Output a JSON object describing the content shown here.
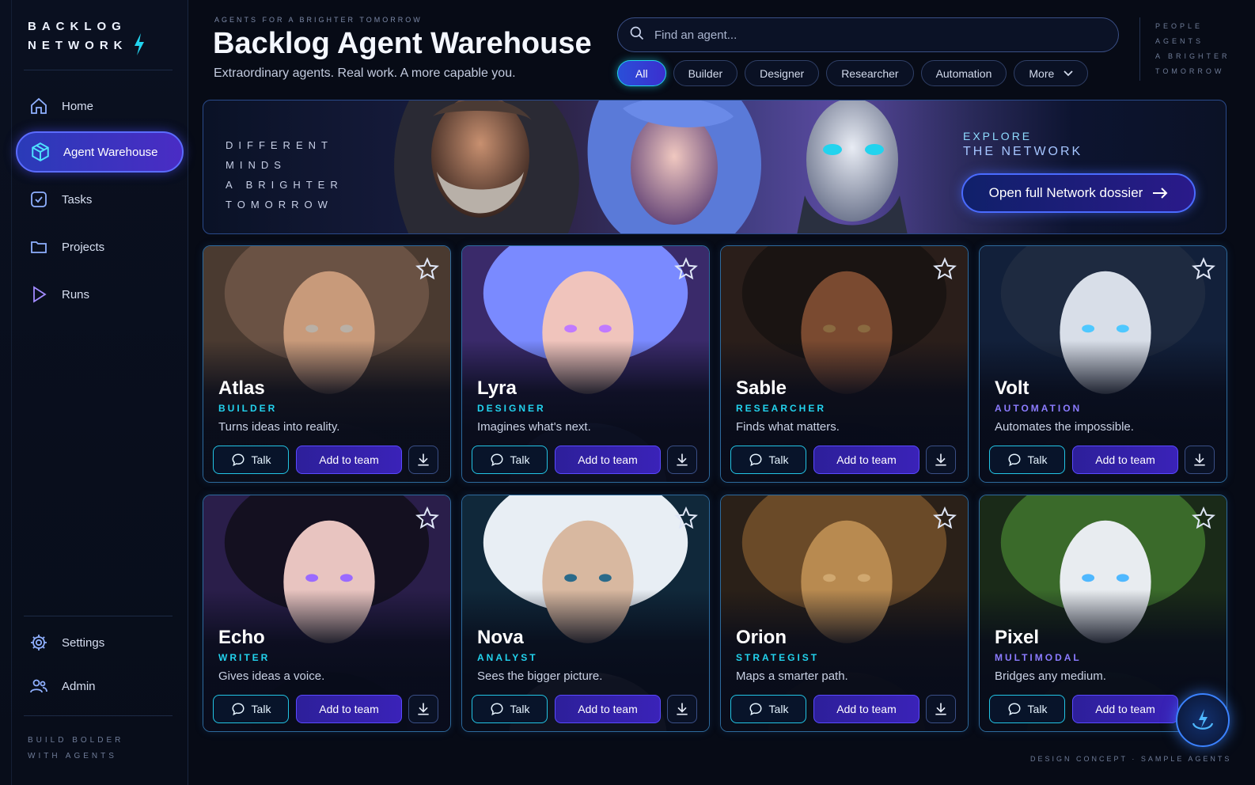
{
  "brand": {
    "line1": "BACKLOG",
    "line2": "NETWORK",
    "accent": "#22d3ee"
  },
  "sidebar": {
    "items": [
      {
        "label": "Home",
        "icon": "home-icon"
      },
      {
        "label": "Agent Warehouse",
        "icon": "box-icon",
        "active": true
      },
      {
        "label": "Tasks",
        "icon": "checkbox-icon"
      },
      {
        "label": "Projects",
        "icon": "folder-icon"
      },
      {
        "label": "Runs",
        "icon": "play-icon"
      }
    ],
    "bottom_items": [
      {
        "label": "Settings",
        "icon": "gear-icon"
      },
      {
        "label": "Admin",
        "icon": "users-icon"
      }
    ],
    "tagline": {
      "line1": "BUILD BOLDER",
      "line2": "WITH AGENTS"
    }
  },
  "header": {
    "eyebrow": "AGENTS FOR A BRIGHTER TOMORROW",
    "title": "Backlog Agent Warehouse",
    "subtitle": "Extraordinary agents. Real work. A more capable you.",
    "search_placeholder": "Find an agent...",
    "filters": [
      "All",
      "Builder",
      "Designer",
      "Researcher",
      "Automation"
    ],
    "more_label": "More",
    "active_filter": "All",
    "side_text": [
      "PEOPLE",
      "AGENTS",
      "A BRIGHTER",
      "TOMORROW"
    ]
  },
  "banner": {
    "lines": [
      "DIFFERENT",
      "MINDS",
      "A BRIGHTER",
      "TOMORROW"
    ],
    "explore_line1": "EXPLORE",
    "explore_line2": "THE NETWORK",
    "cta": "Open full Network dossier"
  },
  "agents": [
    {
      "name": "Atlas",
      "role": "BUILDER",
      "desc": "Turns ideas into reality.",
      "talk": "Talk",
      "add": "Add to team",
      "art": "bearded-man"
    },
    {
      "name": "Lyra",
      "role": "DESIGNER",
      "desc": "Imagines what's next.",
      "talk": "Talk",
      "add": "Add to team",
      "art": "blue-haired-woman"
    },
    {
      "name": "Sable",
      "role": "RESEARCHER",
      "desc": "Finds what matters.",
      "talk": "Talk",
      "add": "Add to team",
      "art": "curly-haired-woman"
    },
    {
      "name": "Volt",
      "role": "AUTOMATION",
      "desc": "Automates the impossible.",
      "talk": "Talk",
      "add": "Add to team",
      "art": "white-robot"
    },
    {
      "name": "Echo",
      "role": "WRITER",
      "desc": "Gives ideas a voice.",
      "talk": "Talk",
      "add": "Add to team",
      "art": "headphones-girl"
    },
    {
      "name": "Nova",
      "role": "ANALYST",
      "desc": "Sees the bigger picture.",
      "talk": "Talk",
      "add": "Add to team",
      "art": "white-haired-man"
    },
    {
      "name": "Orion",
      "role": "STRATEGIST",
      "desc": "Maps a smarter path.",
      "talk": "Talk",
      "add": "Add to team",
      "art": "lion"
    },
    {
      "name": "Pixel",
      "role": "MULTIMODAL",
      "desc": "Bridges any medium.",
      "talk": "Talk",
      "add": "Add to team",
      "art": "cute-robot"
    }
  ],
  "footer": "DESIGN CONCEPT · SAMPLE AGENTS"
}
